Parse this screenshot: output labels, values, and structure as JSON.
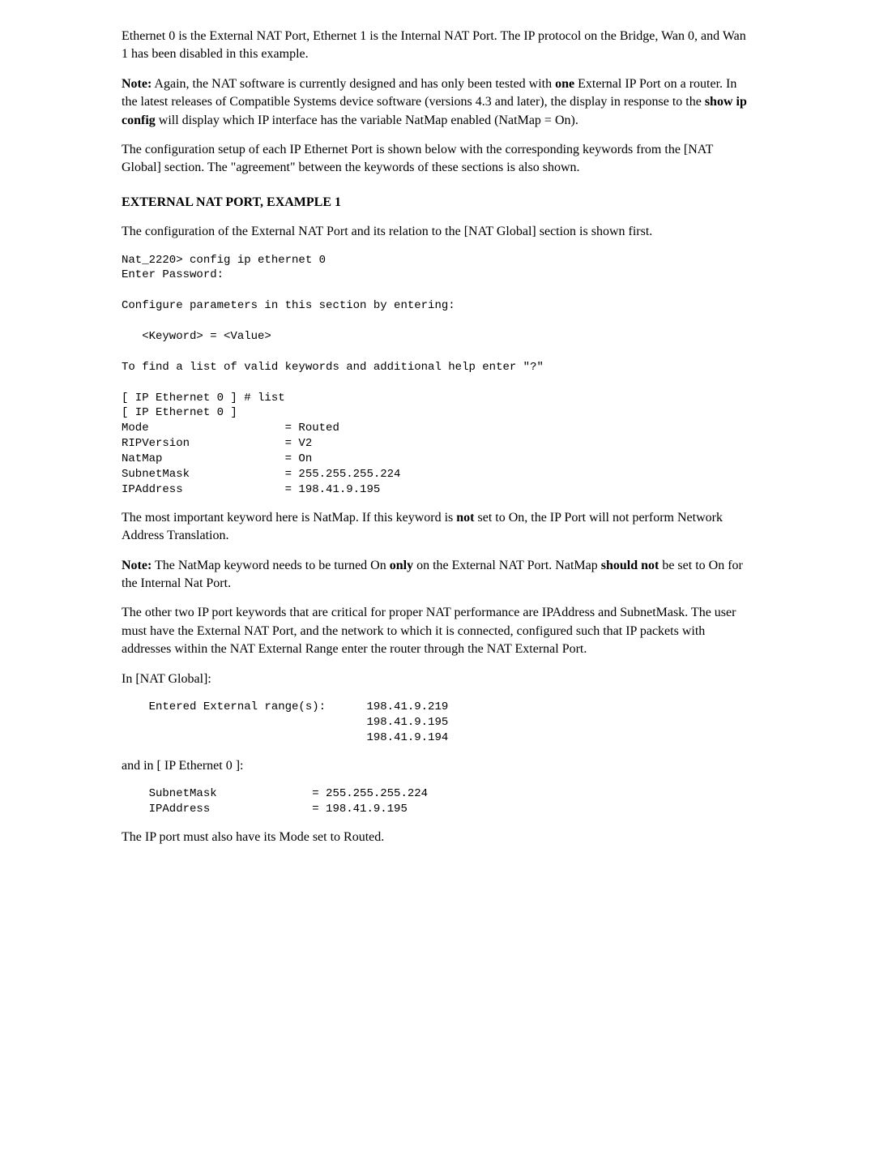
{
  "p1": {
    "text": "Ethernet 0 is the External NAT Port, Ethernet 1 is the Internal NAT Port. The IP protocol on the Bridge, Wan 0, and Wan 1 has been disabled in this example."
  },
  "p2": {
    "prefix_bold": "Note:",
    "mid1": " Again, the NAT software is currently designed and has only been tested with ",
    "bold1": "one",
    "mid2": " External IP Port on a router. In the latest releases of Compatible Systems device software (versions 4.3 and later), the display in response to the ",
    "bold2": "show ip config",
    "mid3": " will display which IP interface has the variable NatMap enabled (NatMap = On)."
  },
  "p3": {
    "text": "The configuration setup of each IP Ethernet Port is shown below with the corresponding keywords from the [NAT Global] section. The \"agreement\" between the keywords of these sections is also shown."
  },
  "h1": "EXTERNAL NAT PORT, EXAMPLE 1",
  "p4": {
    "text": "The configuration of the External NAT Port and its relation to the [NAT Global] section is shown first."
  },
  "pre1": "Nat_2220> config ip ethernet 0\nEnter Password:\n\nConfigure parameters in this section by entering:\n\n   <Keyword> = <Value>\n\nTo find a list of valid keywords and additional help enter \"?\"\n\n[ IP Ethernet 0 ] # list\n[ IP Ethernet 0 ]\nMode                    = Routed\nRIPVersion              = V2\nNatMap                  = On\nSubnetMask              = 255.255.255.224\nIPAddress               = 198.41.9.195",
  "p5": {
    "pre": "The most important keyword here is NatMap. If this keyword is ",
    "bold": "not",
    "post": " set to On, the IP Port will not perform Network Address Translation."
  },
  "p6": {
    "prefix_bold": "Note:",
    "mid1": " The NatMap keyword needs to be turned On ",
    "bold1": "only",
    "mid2": " on the External NAT Port. NatMap ",
    "bold2": "should not",
    "mid3": " be set to On for the Internal Nat Port."
  },
  "p7": {
    "text": "The other two IP port keywords that are critical for proper NAT performance are IPAddress and SubnetMask. The user must have the External NAT Port, and the network to which it is connected, configured such that IP packets with addresses within the NAT External Range enter the router through the NAT External Port."
  },
  "p8": {
    "text": "In [NAT Global]:"
  },
  "pre2": "    Entered External range(s):      198.41.9.219\n                                    198.41.9.195\n                                    198.41.9.194",
  "p9": {
    "text": "and in [ IP Ethernet 0 ]:"
  },
  "pre3": "    SubnetMask              = 255.255.255.224\n    IPAddress               = 198.41.9.195",
  "p10": {
    "text": "The IP port must also have its Mode set to Routed."
  }
}
